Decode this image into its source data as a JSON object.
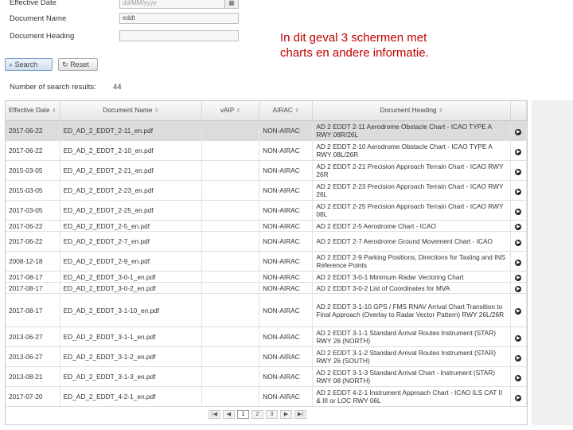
{
  "form": {
    "effective_date_label": "Effective Date",
    "effective_date_placeholder": "dd/MM/yyyy",
    "document_name_label": "Document Name",
    "document_name_value": "eddt",
    "document_heading_label": "Document Heading",
    "search_label": "Search",
    "reset_label": "Reset",
    "results_label": "Number of search results:",
    "results_count": "44"
  },
  "annotation": "In dit geval 3 schermen met charts en andere informatie.",
  "table": {
    "headers": [
      "Effective Date",
      "Document Name",
      "vAIP",
      "AIRAC",
      "Document Heading"
    ],
    "rows": [
      {
        "date": "2017-06-22",
        "name": "ED_AD_2_EDDT_2-11_en.pdf",
        "airac": "NON-AIRAC",
        "heading": "AD 2 EDDT 2-11 Aerodrome Obstacle Chart - ICAO TYPE A RWY 08R/26L"
      },
      {
        "date": "2017-06-22",
        "name": "ED_AD_2_EDDT_2-10_en.pdf",
        "airac": "NON-AIRAC",
        "heading": "AD 2 EDDT 2-10 Aerodrome Obstacle Chart - ICAO TYPE A RWY 08L/26R"
      },
      {
        "date": "2015-03-05",
        "name": "ED_AD_2_EDDT_2-21_en.pdf",
        "airac": "NON-AIRAC",
        "heading": "AD 2 EDDT 2-21 Precision Approach Terrain Chart - ICAO RWY 26R"
      },
      {
        "date": "2015-03-05",
        "name": "ED_AD_2_EDDT_2-23_en.pdf",
        "airac": "NON-AIRAC",
        "heading": "AD 2 EDDT 2-23 Precision Approach Terrain Chart - ICAO RWY 26L"
      },
      {
        "date": "2017-03-05",
        "name": "ED_AD_2_EDDT_2-25_en.pdf",
        "airac": "NON-AIRAC",
        "heading": "AD 2 EDDT 2-25 Precision Approach Terrain Chart - ICAO RWY 08L"
      },
      {
        "date": "2017-06-22",
        "name": "ED_AD_2_EDDT_2-5_en.pdf",
        "airac": "NON-AIRAC",
        "heading": "AD 2 EDDT 2-5 Aerodrome Chart - ICAO"
      },
      {
        "date": "2017-06-22",
        "name": "ED_AD_2_EDDT_2-7_en.pdf",
        "airac": "NON-AIRAC",
        "heading": "AD 2 EDDT 2-7 Aerodrome Ground Movement Chart - ICAO"
      },
      {
        "date": "2008-12-18",
        "name": "ED_AD_2_EDDT_2-9_en.pdf",
        "airac": "NON-AIRAC",
        "heading": "AD 2 EDDT 2-9 Parking Positions, Directions for Taxiing and INS Reference Points"
      },
      {
        "date": "2017-08-17",
        "name": "ED_AD_2_EDDT_3-0-1_en.pdf",
        "airac": "NON-AIRAC",
        "heading": "AD 2 EDDT 3-0-1 Minimum Radar Vectoring Chart"
      },
      {
        "date": "2017-08-17",
        "name": "ED_AD_2_EDDT_3-0-2_en.pdf",
        "airac": "NON-AIRAC",
        "heading": "AD 2 EDDT 3-0-2 List of Coordinates for MVA"
      },
      {
        "date": "2017-08-17",
        "name": "ED_AD_2_EDDT_3-1-10_en.pdf",
        "airac": "NON-AIRAC",
        "heading": "AD 2 EDDT 3-1-10 GPS / FMS RNAV Arrival Chart Transition to Final Approach (Overlay to Radar Vector Pattern) RWY 26L/26R"
      },
      {
        "date": "2013-06-27",
        "name": "ED_AD_2_EDDT_3-1-1_en.pdf",
        "airac": "NON-AIRAC",
        "heading": "AD 2 EDDT 3-1-1 Standard Arrival Routes Instrument (STAR) RWY 26 (NORTH)"
      },
      {
        "date": "2013-06-27",
        "name": "ED_AD_2_EDDT_3-1-2_en.pdf",
        "airac": "NON-AIRAC",
        "heading": "AD 2 EDDT 3-1-2 Standard Arrival Routes Instrument (STAR) RWY 26 (SOUTH)"
      },
      {
        "date": "2013-08-21",
        "name": "ED_AD_2_EDDT_3-1-3_en.pdf",
        "airac": "NON-AIRAC",
        "heading": "AD 2 EDDT 3-1-3 Standard Arrival Chart - Instrument (STAR) RWY 08 (NORTH)"
      },
      {
        "date": "2017-07-20",
        "name": "ED_AD_2_EDDT_4-2-1_en.pdf",
        "airac": "NON-AIRAC",
        "heading": "AD 2 EDDT 4-2-1 Instrument Approach Chart - ICAO ILS CAT II & III or LOC RWY 06L"
      }
    ]
  },
  "pager": {
    "first": "|◀",
    "prev": "◀",
    "pages": [
      "1",
      "2",
      "3"
    ],
    "next": "▶",
    "last": "▶|"
  }
}
